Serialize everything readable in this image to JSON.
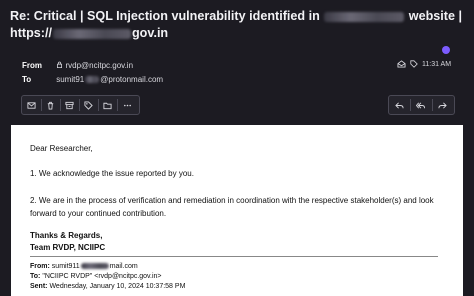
{
  "subject": {
    "line1_prefix": "Re: Critical | SQL Injection vulnerability identified in",
    "line1_suffix": "website |",
    "line2_prefix": "https://",
    "line2_suffix": "gov.in"
  },
  "header": {
    "from_label": "From",
    "from_value": "rvdp@ncitpc.gov.in",
    "to_label": "To",
    "to_value_prefix": "sumit91",
    "to_value_suffix": "@protonmail.com",
    "time": "11:31 AM"
  },
  "toolbar": {
    "buttons": [
      "mark-unread",
      "move-to-trash",
      "archive",
      "label",
      "move-to-folder",
      "more"
    ],
    "reply_buttons": [
      "reply",
      "reply-all",
      "forward"
    ]
  },
  "body": {
    "greeting": "Dear Researcher,",
    "para1": "1. We acknowledge the issue reported by you.",
    "para2": "2. We are in the process of verification and remediation in coordination with the respective stakeholder(s) and look forward to your continued contribution.",
    "signoff1": "Thanks & Regards,",
    "signoff2": "Team RVDP, NCIIPC"
  },
  "quoted": {
    "from_label": "From:",
    "from_prefix": "sumit911",
    "from_suffix": "mail.com",
    "to_label": "To:",
    "to_value": "\"NCIIPC RVDP\" <rvdp@ncitpc.gov.in>",
    "sent_label": "Sent:",
    "sent_value": "Wednesday, January 10, 2024 10:37:58 PM"
  },
  "colors": {
    "background": "#1c1b22",
    "accent": "#7c5cff",
    "text": "#f2f2f5"
  }
}
